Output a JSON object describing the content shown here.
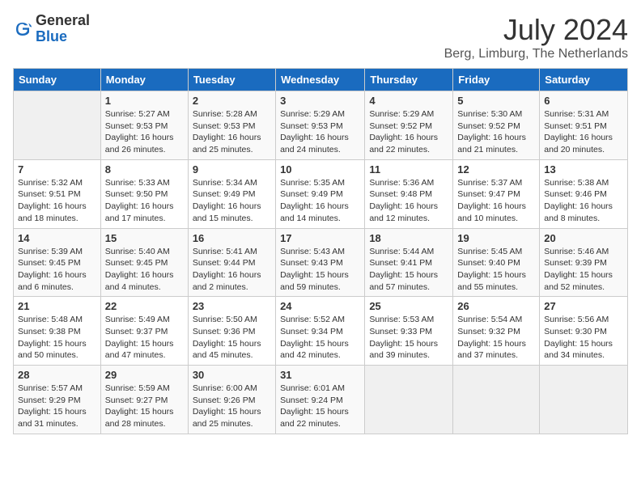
{
  "logo": {
    "general": "General",
    "blue": "Blue"
  },
  "title": "July 2024",
  "location": "Berg, Limburg, The Netherlands",
  "weekdays": [
    "Sunday",
    "Monday",
    "Tuesday",
    "Wednesday",
    "Thursday",
    "Friday",
    "Saturday"
  ],
  "weeks": [
    [
      {
        "day": "",
        "info": ""
      },
      {
        "day": "1",
        "info": "Sunrise: 5:27 AM\nSunset: 9:53 PM\nDaylight: 16 hours\nand 26 minutes."
      },
      {
        "day": "2",
        "info": "Sunrise: 5:28 AM\nSunset: 9:53 PM\nDaylight: 16 hours\nand 25 minutes."
      },
      {
        "day": "3",
        "info": "Sunrise: 5:29 AM\nSunset: 9:53 PM\nDaylight: 16 hours\nand 24 minutes."
      },
      {
        "day": "4",
        "info": "Sunrise: 5:29 AM\nSunset: 9:52 PM\nDaylight: 16 hours\nand 22 minutes."
      },
      {
        "day": "5",
        "info": "Sunrise: 5:30 AM\nSunset: 9:52 PM\nDaylight: 16 hours\nand 21 minutes."
      },
      {
        "day": "6",
        "info": "Sunrise: 5:31 AM\nSunset: 9:51 PM\nDaylight: 16 hours\nand 20 minutes."
      }
    ],
    [
      {
        "day": "7",
        "info": "Sunrise: 5:32 AM\nSunset: 9:51 PM\nDaylight: 16 hours\nand 18 minutes."
      },
      {
        "day": "8",
        "info": "Sunrise: 5:33 AM\nSunset: 9:50 PM\nDaylight: 16 hours\nand 17 minutes."
      },
      {
        "day": "9",
        "info": "Sunrise: 5:34 AM\nSunset: 9:49 PM\nDaylight: 16 hours\nand 15 minutes."
      },
      {
        "day": "10",
        "info": "Sunrise: 5:35 AM\nSunset: 9:49 PM\nDaylight: 16 hours\nand 14 minutes."
      },
      {
        "day": "11",
        "info": "Sunrise: 5:36 AM\nSunset: 9:48 PM\nDaylight: 16 hours\nand 12 minutes."
      },
      {
        "day": "12",
        "info": "Sunrise: 5:37 AM\nSunset: 9:47 PM\nDaylight: 16 hours\nand 10 minutes."
      },
      {
        "day": "13",
        "info": "Sunrise: 5:38 AM\nSunset: 9:46 PM\nDaylight: 16 hours\nand 8 minutes."
      }
    ],
    [
      {
        "day": "14",
        "info": "Sunrise: 5:39 AM\nSunset: 9:45 PM\nDaylight: 16 hours\nand 6 minutes."
      },
      {
        "day": "15",
        "info": "Sunrise: 5:40 AM\nSunset: 9:45 PM\nDaylight: 16 hours\nand 4 minutes."
      },
      {
        "day": "16",
        "info": "Sunrise: 5:41 AM\nSunset: 9:44 PM\nDaylight: 16 hours\nand 2 minutes."
      },
      {
        "day": "17",
        "info": "Sunrise: 5:43 AM\nSunset: 9:43 PM\nDaylight: 15 hours\nand 59 minutes."
      },
      {
        "day": "18",
        "info": "Sunrise: 5:44 AM\nSunset: 9:41 PM\nDaylight: 15 hours\nand 57 minutes."
      },
      {
        "day": "19",
        "info": "Sunrise: 5:45 AM\nSunset: 9:40 PM\nDaylight: 15 hours\nand 55 minutes."
      },
      {
        "day": "20",
        "info": "Sunrise: 5:46 AM\nSunset: 9:39 PM\nDaylight: 15 hours\nand 52 minutes."
      }
    ],
    [
      {
        "day": "21",
        "info": "Sunrise: 5:48 AM\nSunset: 9:38 PM\nDaylight: 15 hours\nand 50 minutes."
      },
      {
        "day": "22",
        "info": "Sunrise: 5:49 AM\nSunset: 9:37 PM\nDaylight: 15 hours\nand 47 minutes."
      },
      {
        "day": "23",
        "info": "Sunrise: 5:50 AM\nSunset: 9:36 PM\nDaylight: 15 hours\nand 45 minutes."
      },
      {
        "day": "24",
        "info": "Sunrise: 5:52 AM\nSunset: 9:34 PM\nDaylight: 15 hours\nand 42 minutes."
      },
      {
        "day": "25",
        "info": "Sunrise: 5:53 AM\nSunset: 9:33 PM\nDaylight: 15 hours\nand 39 minutes."
      },
      {
        "day": "26",
        "info": "Sunrise: 5:54 AM\nSunset: 9:32 PM\nDaylight: 15 hours\nand 37 minutes."
      },
      {
        "day": "27",
        "info": "Sunrise: 5:56 AM\nSunset: 9:30 PM\nDaylight: 15 hours\nand 34 minutes."
      }
    ],
    [
      {
        "day": "28",
        "info": "Sunrise: 5:57 AM\nSunset: 9:29 PM\nDaylight: 15 hours\nand 31 minutes."
      },
      {
        "day": "29",
        "info": "Sunrise: 5:59 AM\nSunset: 9:27 PM\nDaylight: 15 hours\nand 28 minutes."
      },
      {
        "day": "30",
        "info": "Sunrise: 6:00 AM\nSunset: 9:26 PM\nDaylight: 15 hours\nand 25 minutes."
      },
      {
        "day": "31",
        "info": "Sunrise: 6:01 AM\nSunset: 9:24 PM\nDaylight: 15 hours\nand 22 minutes."
      },
      {
        "day": "",
        "info": ""
      },
      {
        "day": "",
        "info": ""
      },
      {
        "day": "",
        "info": ""
      }
    ]
  ]
}
